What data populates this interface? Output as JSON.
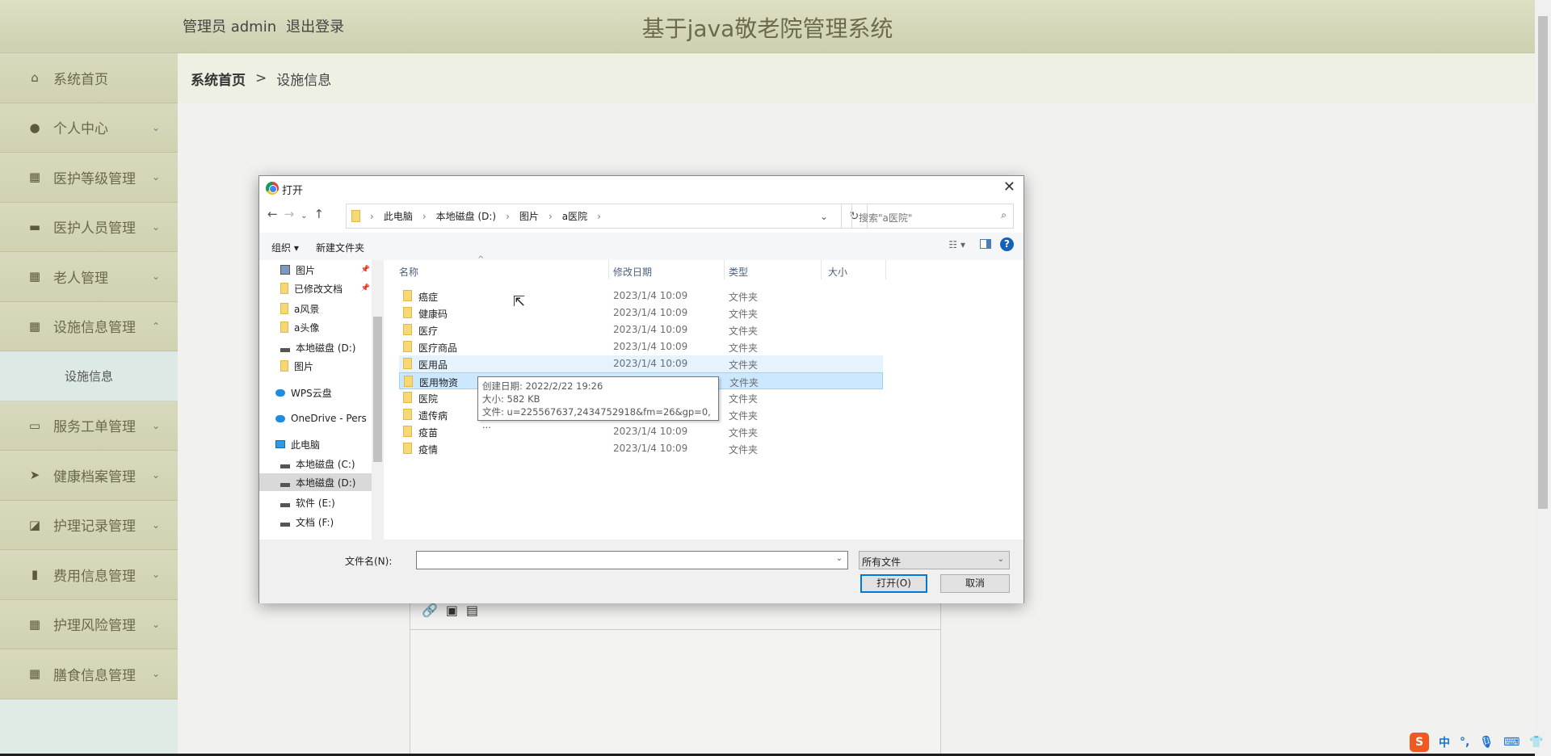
{
  "header": {
    "title": "基于java敬老院管理系统",
    "user": "管理员 admin",
    "logout": "退出登录"
  },
  "sidebar": {
    "items": [
      {
        "label": "系统首页",
        "icon": "home-icon",
        "glyph": "⌂",
        "chevron": ""
      },
      {
        "label": "个人中心",
        "icon": "user-icon",
        "glyph": "●",
        "chevron": "⌄"
      },
      {
        "label": "医护等级管理",
        "icon": "grid-icon",
        "glyph": "▦",
        "chevron": "⌄"
      },
      {
        "label": "医护人员管理",
        "icon": "comment-icon",
        "glyph": "▬",
        "chevron": "⌄"
      },
      {
        "label": "老人管理",
        "icon": "grid-icon",
        "glyph": "▦",
        "chevron": "⌄"
      },
      {
        "label": "设施信息管理",
        "icon": "grid-icon",
        "glyph": "▦",
        "chevron": "⌃",
        "sub": [
          "设施信息"
        ]
      },
      {
        "label": "服务工单管理",
        "icon": "monitor-icon",
        "glyph": "▭",
        "chevron": "⌄"
      },
      {
        "label": "健康档案管理",
        "icon": "send-icon",
        "glyph": "➤",
        "chevron": "⌄"
      },
      {
        "label": "护理记录管理",
        "icon": "chart-icon",
        "glyph": "◪",
        "chevron": "⌄"
      },
      {
        "label": "费用信息管理",
        "icon": "book-icon",
        "glyph": "▮",
        "chevron": "⌄"
      },
      {
        "label": "护理风险管理",
        "icon": "grid-icon",
        "glyph": "▦",
        "chevron": "⌄"
      },
      {
        "label": "膳食信息管理",
        "icon": "grid-icon",
        "glyph": "▦",
        "chevron": "⌄"
      }
    ]
  },
  "breadcrumb": {
    "home": "系统首页",
    "sep": ">",
    "current": "设施信息"
  },
  "editor": {
    "toolbar_icons": [
      "link-icon",
      "image-icon",
      "video-icon"
    ],
    "glyphs": "🔗▣▤"
  },
  "dialog": {
    "title": "打开",
    "path": [
      "此电脑",
      "本地磁盘 (D:)",
      "图片",
      "a医院"
    ],
    "search_placeholder": "搜索\"a医院\"",
    "organize": "组织 ▾",
    "new_folder": "新建文件夹",
    "nav_items": [
      {
        "label": "图片",
        "icon": "img",
        "pinned": true
      },
      {
        "label": "已修改文档",
        "icon": "folder",
        "pinned": true
      },
      {
        "label": "a风景",
        "icon": "folder"
      },
      {
        "label": "a头像",
        "icon": "folder"
      },
      {
        "label": "本地磁盘 (D:)",
        "icon": "drive"
      },
      {
        "label": "图片",
        "icon": "folder"
      },
      {
        "label": "WPS云盘",
        "icon": "cloud"
      },
      {
        "label": "OneDrive - Pers",
        "icon": "cloud"
      },
      {
        "label": "此电脑",
        "icon": "pc"
      },
      {
        "label": "本地磁盘 (C:)",
        "icon": "drive"
      },
      {
        "label": "本地磁盘 (D:)",
        "icon": "drive",
        "selected": true
      },
      {
        "label": "软件 (E:)",
        "icon": "drive"
      },
      {
        "label": "文档 (F:)",
        "icon": "drive"
      }
    ],
    "columns": [
      "名称",
      "修改日期",
      "类型",
      "大小"
    ],
    "files": [
      {
        "name": "癌症",
        "date": "2023/1/4 10:09",
        "type": "文件夹"
      },
      {
        "name": "健康码",
        "date": "2023/1/4 10:09",
        "type": "文件夹"
      },
      {
        "name": "医疗",
        "date": "2023/1/4 10:09",
        "type": "文件夹"
      },
      {
        "name": "医疗商品",
        "date": "2023/1/4 10:09",
        "type": "文件夹"
      },
      {
        "name": "医用品",
        "date": "2023/1/4 10:09",
        "type": "文件夹",
        "state": "hover"
      },
      {
        "name": "医用物资",
        "date": "",
        "type": "文件夹",
        "state": "sel"
      },
      {
        "name": "医院",
        "date": "",
        "type": "文件夹"
      },
      {
        "name": "遗传病",
        "date": "",
        "type": "文件夹"
      },
      {
        "name": "疫苗",
        "date": "2023/1/4 10:09",
        "type": "文件夹"
      },
      {
        "name": "疫情",
        "date": "2023/1/4 10:09",
        "type": "文件夹"
      }
    ],
    "tooltip": [
      "创建日期: 2022/2/22 19:26",
      "大小: 582 KB",
      "文件: u=225567637,2434752918&fm=26&gp=0, ..."
    ],
    "filename_label": "文件名(N):",
    "filename_value": "",
    "filter": "所有文件",
    "open": "打开(O)",
    "cancel": "取消"
  },
  "ime": {
    "logo": "S",
    "mode": "中",
    "punct": "°,",
    "icons": [
      "mic-icon",
      "keyboard-icon",
      "skin-icon",
      "grid-icon"
    ]
  }
}
